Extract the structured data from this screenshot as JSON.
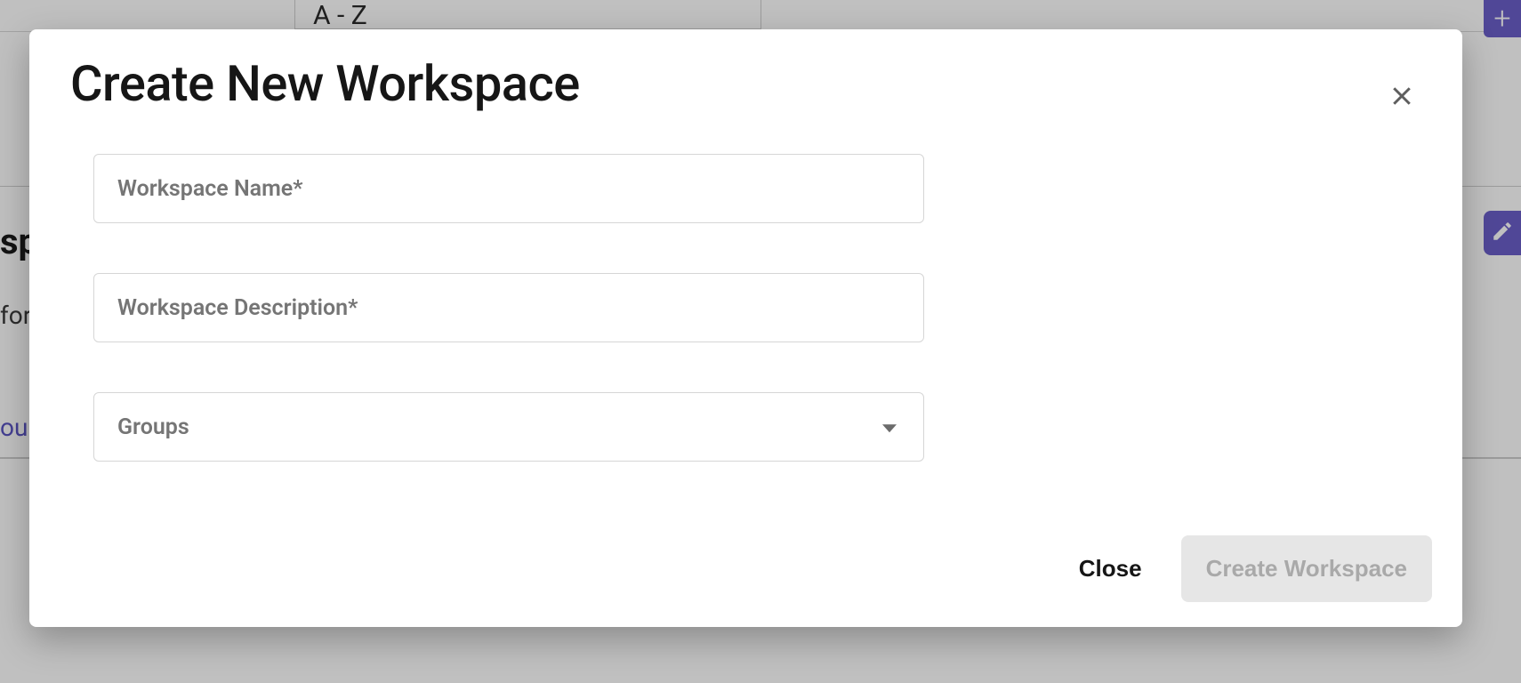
{
  "background": {
    "sort_value": "A - Z",
    "heading_fragment": "spa",
    "sub_fragment": "for",
    "link_fragment": "oup"
  },
  "modal": {
    "title": "Create New Workspace",
    "fields": {
      "name": {
        "label": "Workspace Name*",
        "value": ""
      },
      "description": {
        "label": "Workspace Description*",
        "value": ""
      },
      "groups": {
        "label": "Groups",
        "selected": ""
      }
    },
    "actions": {
      "close_label": "Close",
      "create_label": "Create Workspace",
      "create_enabled": false
    }
  }
}
